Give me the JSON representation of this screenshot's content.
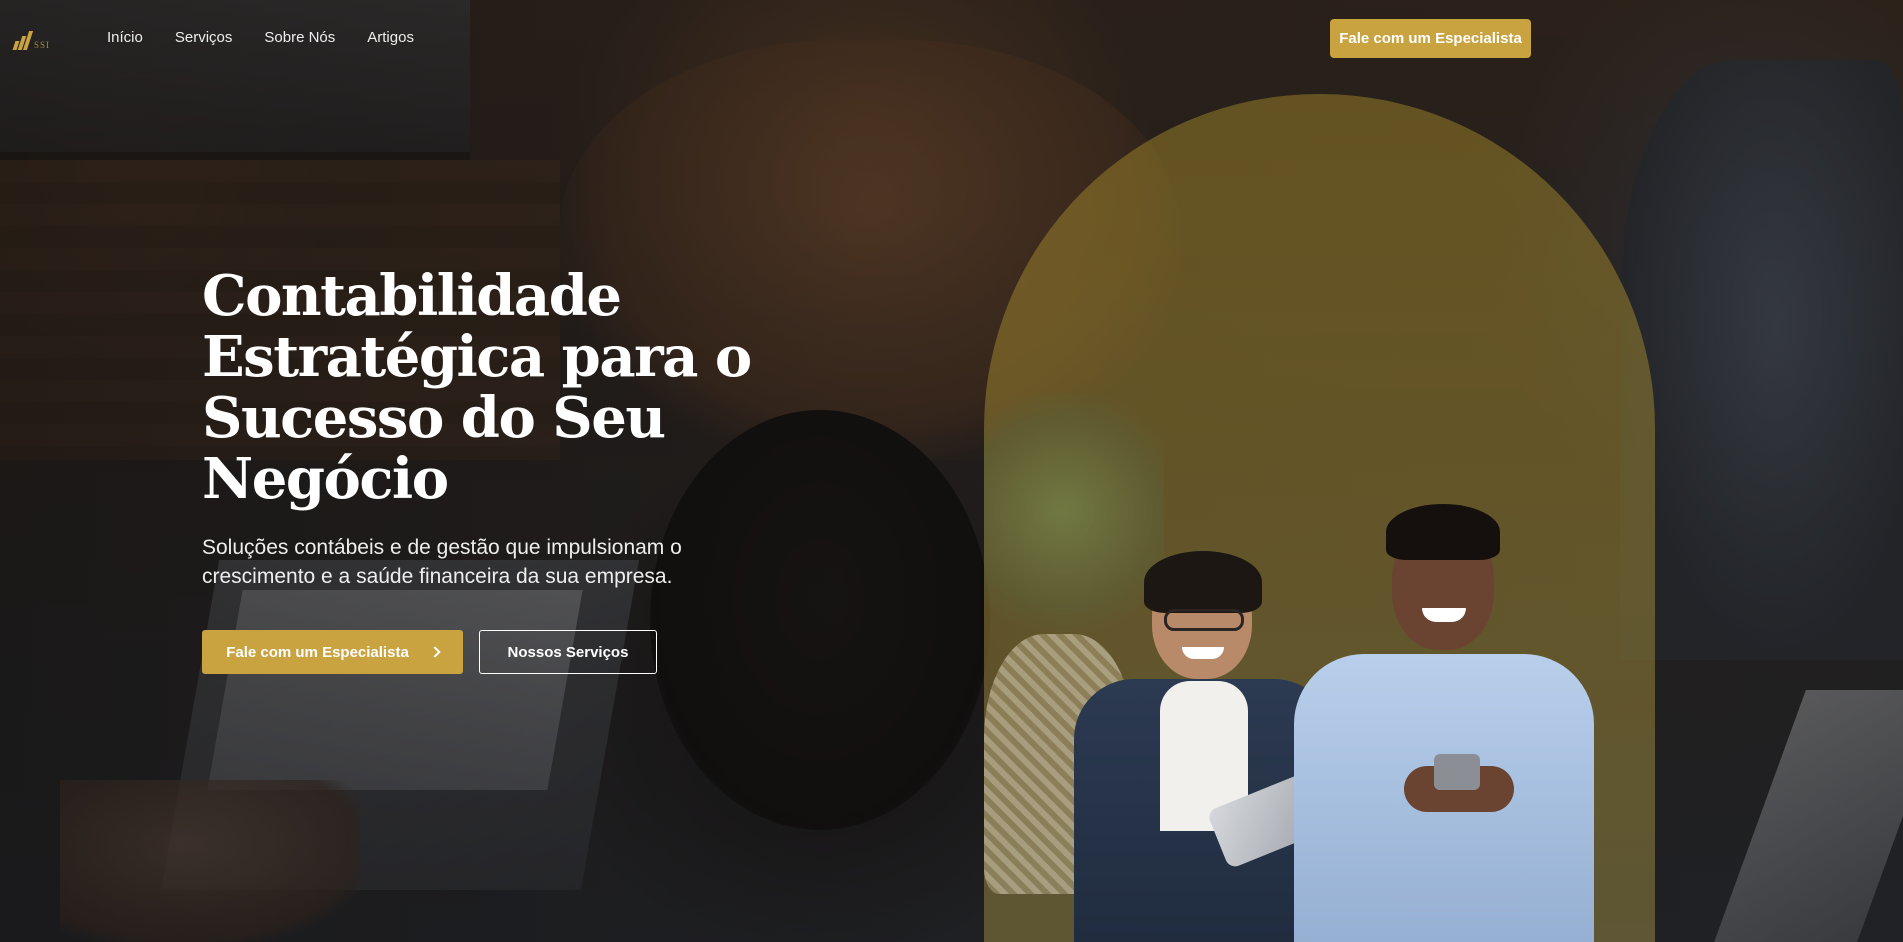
{
  "brand": {
    "logo_icon": "bars-logo-icon",
    "logo_wordmark": "SSI"
  },
  "nav": {
    "items": [
      {
        "label": "Início"
      },
      {
        "label": "Serviços"
      },
      {
        "label": "Sobre Nós"
      },
      {
        "label": "Artigos"
      }
    ]
  },
  "header": {
    "cta_label": "Fale com um Especialista"
  },
  "hero": {
    "title": "Contabilidade Estratégica para o Sucesso do Seu Negócio",
    "subtitle": "Soluções contábeis e de gestão que impulsionam o crescimento e a saúde financeira da sua empresa.",
    "primary_button": "Fale com um Especialista",
    "primary_button_icon": "chevron-right-icon",
    "secondary_button": "Nossos Serviços"
  },
  "colors": {
    "accent": "#c9a33f",
    "text": "#ffffff",
    "overlay": "#1a1717"
  }
}
